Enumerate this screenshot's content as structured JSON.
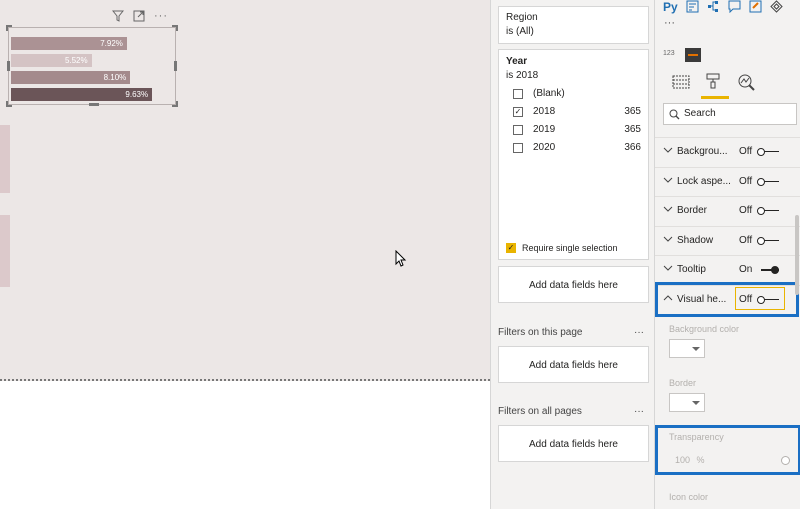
{
  "visual": {
    "bars": [
      {
        "label": "7.92%",
        "fraction": 0.69,
        "color": "#ab9294"
      },
      {
        "label": "5.52%",
        "fraction": 0.48,
        "color": "#d4c3c4"
      },
      {
        "label": "8.10%",
        "fraction": 0.71,
        "color": "#a48a8c"
      },
      {
        "label": "9.63%",
        "fraction": 0.84,
        "color": "#6b5558"
      }
    ]
  },
  "filters": {
    "region": {
      "title": "Region",
      "value": "is (All)"
    },
    "year": {
      "title": "Year",
      "value": "is 2018",
      "options": [
        {
          "label": "(Blank)",
          "count": "",
          "checked": false
        },
        {
          "label": "2018",
          "count": "365",
          "checked": true
        },
        {
          "label": "2019",
          "count": "365",
          "checked": false
        },
        {
          "label": "2020",
          "count": "366",
          "checked": false
        }
      ],
      "require_single": "Require single selection"
    },
    "add_fields_visual": "Add data fields here",
    "page_section": "Filters on this page",
    "add_fields_page": "Add data fields here",
    "all_section": "Filters on all pages",
    "add_fields_all": "Add data fields here",
    "more": "···"
  },
  "format": {
    "py_label": "Py",
    "more": "···",
    "search_placeholder": "Search",
    "badge_123": "123",
    "rows": [
      {
        "name": "Backgrou...",
        "state": "Off",
        "on": false
      },
      {
        "name": "Lock aspe...",
        "state": "Off",
        "on": false
      },
      {
        "name": "Border",
        "state": "Off",
        "on": false
      },
      {
        "name": "Shadow",
        "state": "Off",
        "on": false
      },
      {
        "name": "Tooltip",
        "state": "On",
        "on": true
      },
      {
        "name": "Visual he...",
        "state": "Off",
        "on": false
      }
    ],
    "bg_color_label": "Background color",
    "border_label": "Border",
    "transparency_label": "Transparency",
    "transparency_value": "100",
    "transparency_unit": "%",
    "icon_color_label": "Icon color",
    "accent": "#1a6fc4"
  }
}
